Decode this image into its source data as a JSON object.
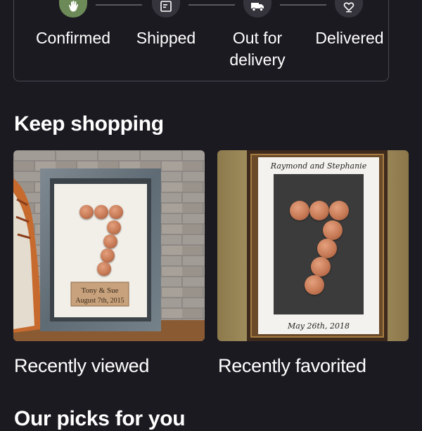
{
  "order_status": {
    "steps": [
      {
        "label": "Confirmed",
        "icon": "waving-hand-icon",
        "state": "complete"
      },
      {
        "label": "Shipped",
        "icon": "package-label-icon",
        "state": "pending"
      },
      {
        "label": "Out for\ndelivery",
        "icon": "delivery-truck-icon",
        "state": "pending"
      },
      {
        "label": "Delivered",
        "icon": "heart-package-icon",
        "state": "pending"
      }
    ],
    "complete_color": "#6c8a58"
  },
  "keep_shopping": {
    "title": "Keep shopping",
    "cards": [
      {
        "caption": "Recently viewed",
        "plaque_line1": "Tony & Sue",
        "plaque_line2": "August 7th, 2015"
      },
      {
        "caption": "Recently favorited",
        "top_text": "Raymond and Stephanie",
        "bottom_text": "May 26th, 2018"
      }
    ]
  },
  "our_picks": {
    "title": "Our picks for you"
  }
}
